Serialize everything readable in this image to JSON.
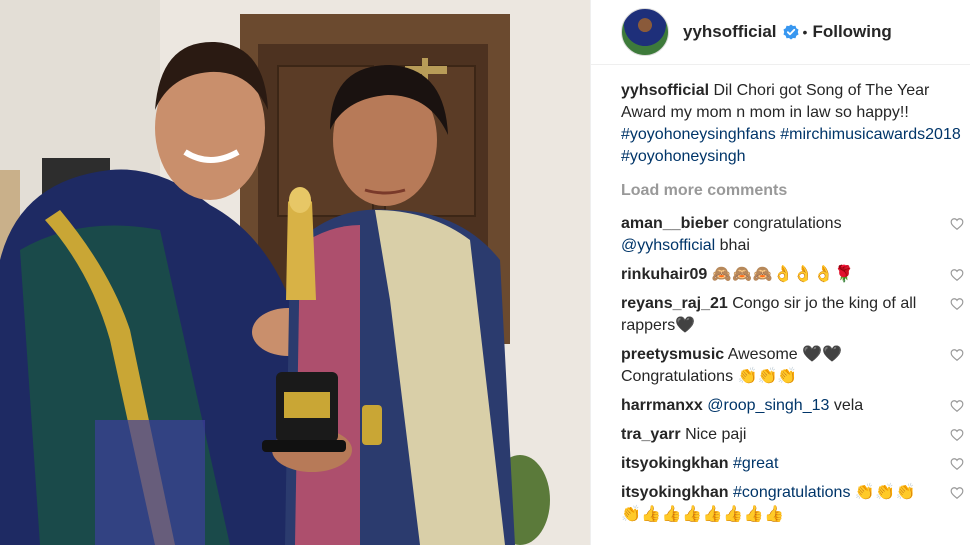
{
  "header": {
    "username": "yyhsofficial",
    "separator": "•",
    "follow_status": "Following",
    "verified_icon": "verified-badge-icon",
    "verified_color": "#3897f0"
  },
  "caption": {
    "username": "yyhsofficial",
    "text": "Dil Chori got Song of The Year Award my mom n mom in law so happy!!",
    "hashtags": [
      "#yoyohoneysinghfans",
      "#mirchimusicawards2018",
      "#yoyohoneysingh"
    ]
  },
  "load_more": "Load more comments",
  "comments": [
    {
      "user": "aman__bieber",
      "text": "congratulations",
      "mention": "@yyhsofficial",
      "text2": "bhai⁣⁣⁣"
    },
    {
      "user": "rinkuhair09",
      "text": "🙈🙈🙈👌👌👌🌹"
    },
    {
      "user": "reyans_raj_21",
      "text": "Congo sir jo the king of all rappers🖤"
    },
    {
      "user": "preetysmusic",
      "text": "Awesome 🖤🖤 Congratulations 👏👏👏"
    },
    {
      "user": "harrmanxx",
      "mention": "@roop_singh_13",
      "text": "vela"
    },
    {
      "user": "tra_yarr",
      "text": "Nice paji"
    },
    {
      "user": "itsyokingkhan",
      "tag": "#great"
    },
    {
      "user": "itsyokingkhan",
      "tag": "#congratulations",
      "text": "👏👏👏👏👍👍👍👍👍👍👍"
    }
  ],
  "colors": {
    "link": "#003569",
    "muted": "#999999",
    "text": "#262626",
    "border": "#efefef"
  },
  "icons": {
    "like": "heart-outline-icon"
  }
}
